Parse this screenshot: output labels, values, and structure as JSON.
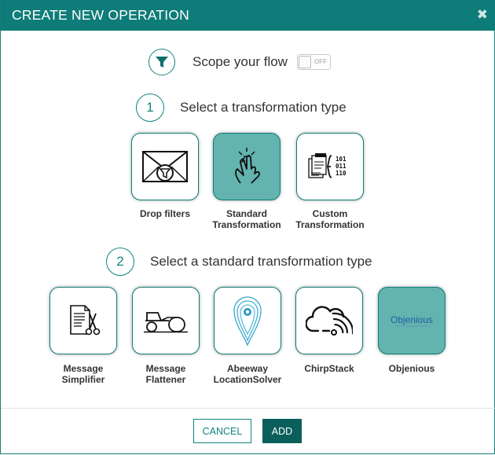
{
  "dialog": {
    "title": "CREATE NEW OPERATION",
    "close_icon": "close-icon"
  },
  "scope": {
    "label": "Scope your flow",
    "toggle_state": "OFF"
  },
  "step1": {
    "number": "1",
    "label": "Select a transformation type",
    "options": [
      {
        "line1": "Drop filters",
        "line2": "",
        "icon": "envelope-filter-icon",
        "selected": false
      },
      {
        "line1": "Standard",
        "line2": "Transformation",
        "icon": "hand-touch-icon",
        "selected": true
      },
      {
        "line1": "Custom",
        "line2": "Transformation",
        "icon": "code-documents-icon",
        "selected": false
      }
    ]
  },
  "step2": {
    "number": "2",
    "label": "Select a standard transformation type",
    "options": [
      {
        "line1": "Message",
        "line2": "Simplifier",
        "icon": "document-scissors-icon",
        "selected": false
      },
      {
        "line1": "Message",
        "line2": "Flattener",
        "icon": "road-roller-icon",
        "selected": false
      },
      {
        "line1": "Abeeway",
        "line2": "LocationSolver",
        "icon": "location-pin-icon",
        "selected": false
      },
      {
        "line1": "ChirpStack",
        "line2": "",
        "icon": "chirpstack-cloud-icon",
        "selected": false
      },
      {
        "line1": "Objenious",
        "line2": "",
        "icon": "objenious-logo",
        "logo_text": "Objenious",
        "selected": true
      }
    ]
  },
  "footer": {
    "cancel_label": "CANCEL",
    "add_label": "ADD"
  },
  "colors": {
    "header": "#0e7c78",
    "accent": "#11847f",
    "selected_tile": "#63b3ae",
    "add_button": "#0a5f5b"
  }
}
